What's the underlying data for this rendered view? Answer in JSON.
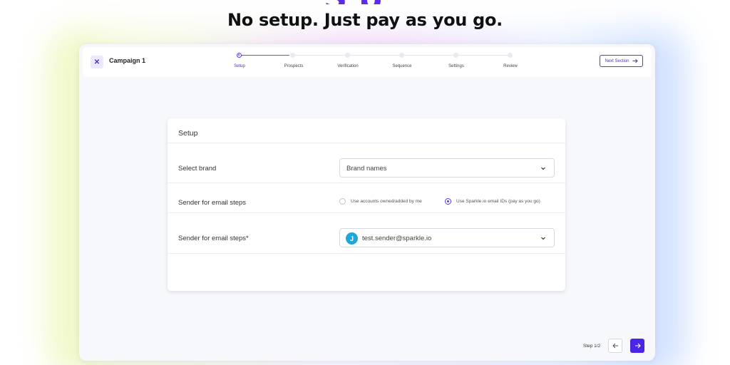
{
  "page": {
    "headline": "No setup. Just pay as you go.",
    "partial_heading_fragment": "S p"
  },
  "topbar": {
    "close_icon": "close-icon",
    "campaign_name": "Campaign 1",
    "next_section_label": "Next Section",
    "steps": [
      {
        "label": "Setup",
        "active": true
      },
      {
        "label": "Prospects",
        "active": false
      },
      {
        "label": "Verification",
        "active": false
      },
      {
        "label": "Sequence",
        "active": false
      },
      {
        "label": "Settings",
        "active": false
      },
      {
        "label": "Review",
        "active": false
      }
    ]
  },
  "card": {
    "title": "Setup",
    "brand": {
      "label": "Select brand",
      "placeholder": "Brand names"
    },
    "sender_type": {
      "label": "Sender for email steps",
      "options": [
        {
          "label": "Use accounts owned/added by me",
          "checked": false
        },
        {
          "label": "Use Sparkle.io email IDs (pay as you go)",
          "checked": true
        }
      ]
    },
    "sender": {
      "label": "Sender for email steps*",
      "avatar_initial": "J",
      "value": "test.sender@sparkle.io"
    }
  },
  "footer": {
    "step_indicator": "Step 1/2",
    "prev_icon": "arrow-left-icon",
    "next_icon": "arrow-right-icon"
  },
  "colors": {
    "accent": "#4a25e8",
    "avatar": "#1ea7d8"
  }
}
